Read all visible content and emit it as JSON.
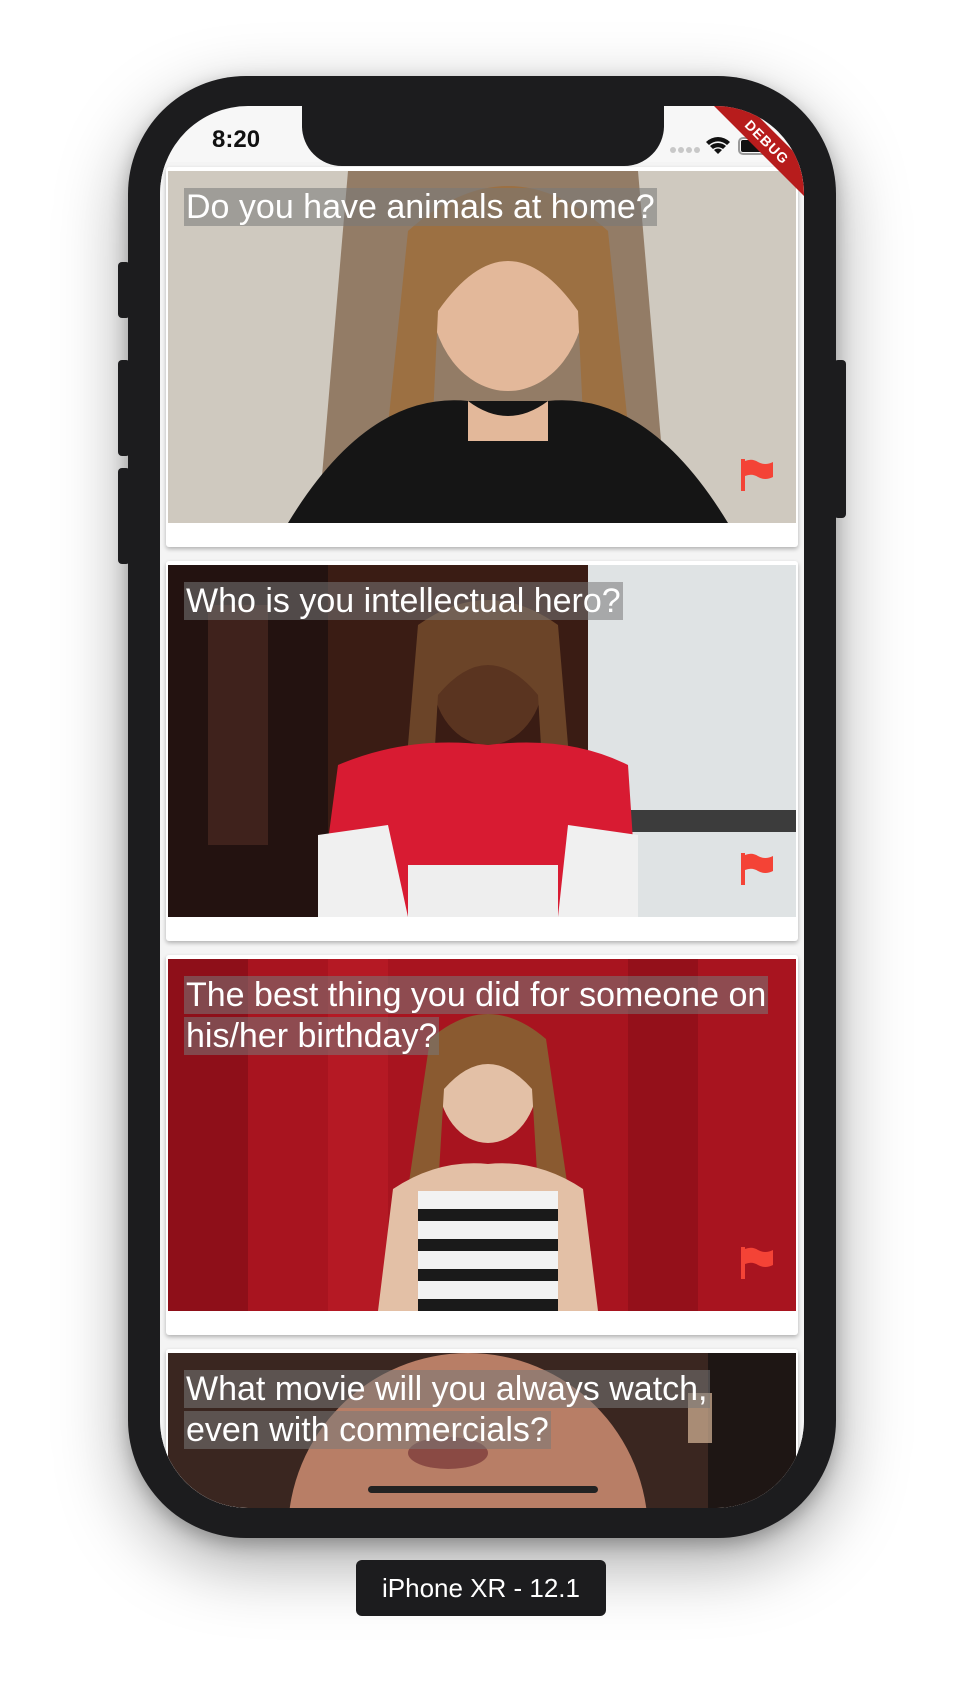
{
  "device": {
    "label": "iPhone XR - 12.1"
  },
  "status_bar": {
    "time": "8:20",
    "debug_banner": "DEBUG"
  },
  "feed": {
    "cards": [
      {
        "question": "Do you have animals at home?",
        "flag_color": "#f44336"
      },
      {
        "question": "Who is you intellectual hero?",
        "flag_color": "#f44336"
      },
      {
        "question": "The best thing you did for someone on his/her birthday?",
        "flag_color": "#f44336"
      },
      {
        "question": "What movie will you always watch, even with commercials?",
        "flag_color": "#f44336"
      }
    ]
  },
  "icons": [
    "signal-icon",
    "wifi-icon",
    "battery-icon",
    "flag-icon"
  ]
}
